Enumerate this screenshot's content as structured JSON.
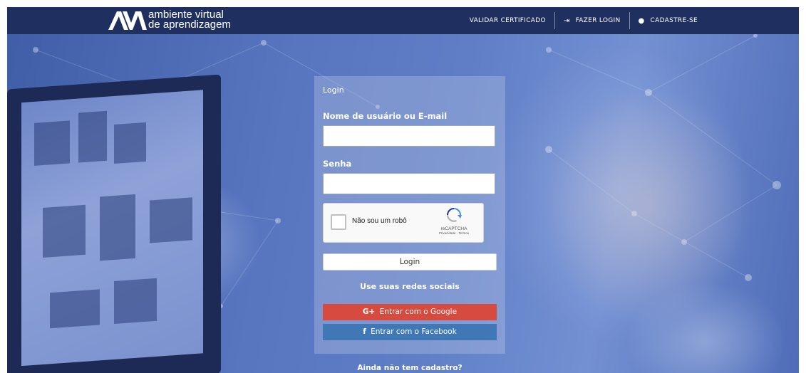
{
  "header": {
    "logo_line1": "ambiente  virtual",
    "logo_line2": "de aprendizagem",
    "nav": [
      {
        "label": "VALIDAR CERTIFICADO",
        "icon": ""
      },
      {
        "label": "FAZER LOGIN",
        "icon": "login-icon"
      },
      {
        "label": "CADASTRE-SE",
        "icon": "user-icon"
      }
    ]
  },
  "login": {
    "title": "Login",
    "username_label": "Nome de usuário ou E-mail",
    "username_value": "",
    "password_label": "Senha",
    "password_value": "",
    "recaptcha": {
      "label": "Não sou um robô",
      "brand": "reCAPTCHA",
      "links": "Privacidade - Termos"
    },
    "submit_label": "Login",
    "social_title": "Use suas redes sociais",
    "google_label": "Entrar com o Google",
    "facebook_label": "Entrar com o Facebook",
    "google_icon": "G+",
    "facebook_icon": "f"
  },
  "footer_text": "Ainda não tem cadastro?",
  "colors": {
    "header_bg": "#1f2f5f",
    "google": "#d64a3f",
    "facebook": "#3f78b4"
  }
}
